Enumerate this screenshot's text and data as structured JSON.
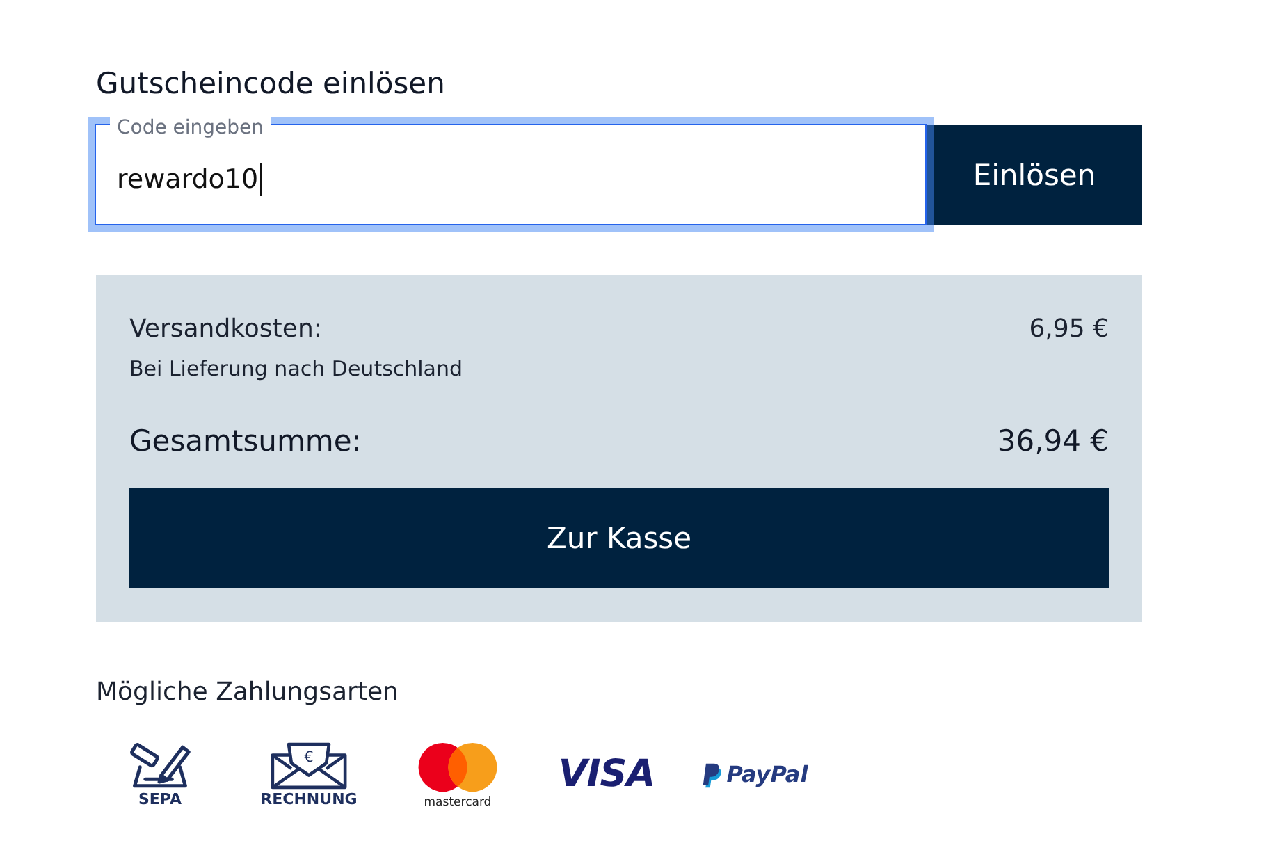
{
  "voucher": {
    "title": "Gutscheincode einlösen",
    "field": {
      "label": "Code eingeben",
      "value": "rewardo10",
      "focused": true
    },
    "button": "Einlösen"
  },
  "summary": {
    "shipping": {
      "label": "Versandkosten:",
      "amount": "6,95 €",
      "note": "Bei Lieferung nach Deutschland"
    },
    "total": {
      "label": "Gesamtsumme:",
      "amount": "36,94 €"
    },
    "checkout_button": "Zur Kasse"
  },
  "payment_methods": {
    "title": "Mögliche Zahlungsarten",
    "items": [
      {
        "kind": "sepa",
        "label": "SEPA"
      },
      {
        "kind": "invoice",
        "symbol": "€",
        "label": "RECHNUNG"
      },
      {
        "kind": "mastercard",
        "label": "mastercard"
      },
      {
        "kind": "visa",
        "label": "VISA"
      },
      {
        "kind": "paypal",
        "label": "PayPal"
      }
    ]
  }
}
